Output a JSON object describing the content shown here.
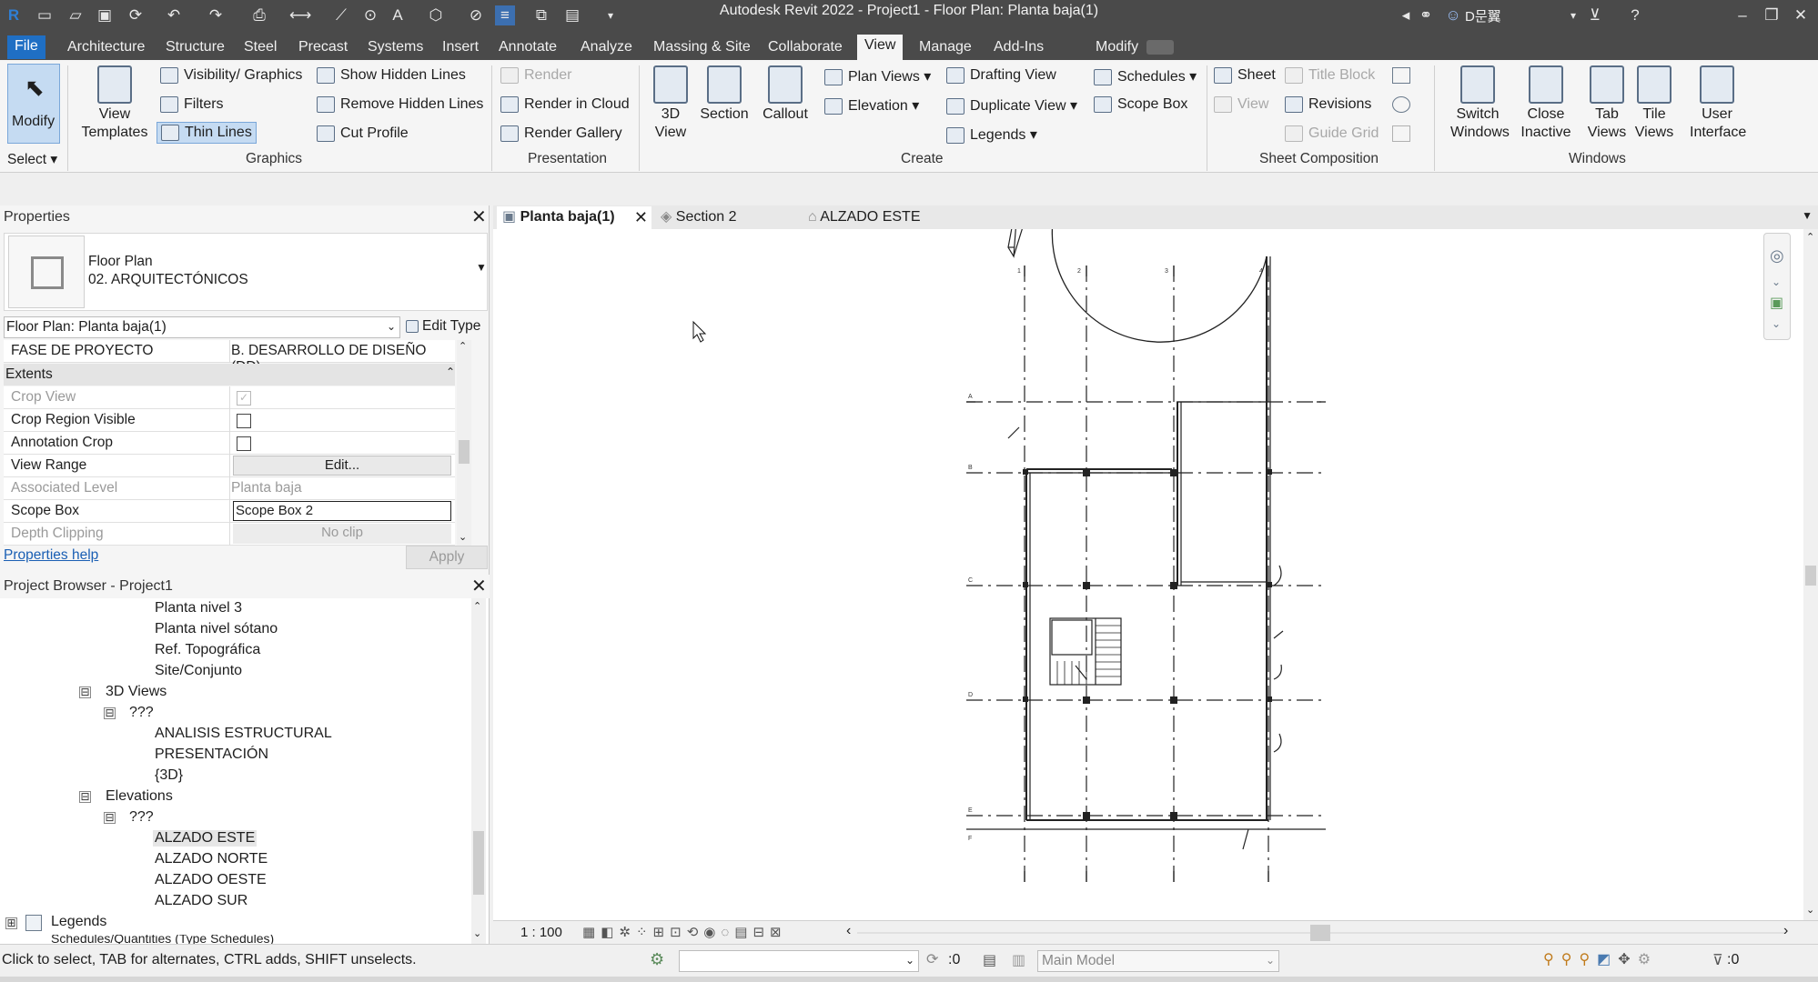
{
  "title_bar": {
    "app_title": "Autodesk Revit 2022 - Project1 - Floor Plan: Planta baja(1)",
    "user_name": "D문翼"
  },
  "menu": [
    "File",
    "Architecture",
    "Structure",
    "Steel",
    "Precast",
    "Systems",
    "Insert",
    "Annotate",
    "Analyze",
    "Massing & Site",
    "Collaborate",
    "View",
    "Manage",
    "Add-Ins",
    "Modify"
  ],
  "menu_active": "View",
  "ribbon": {
    "select": {
      "modify": "Modify",
      "select": "Select"
    },
    "graphics": {
      "label": "Graphics",
      "view_templates": "View Templates",
      "visibility": "Visibility/ Graphics",
      "filters": "Filters",
      "thin_lines": "Thin Lines",
      "show_hidden": "Show  Hidden Lines",
      "remove_hidden": "Remove  Hidden Lines",
      "cut_profile": "Cut  Profile"
    },
    "presentation": {
      "label": "Presentation",
      "render": "Render",
      "render_cloud": "Render  in Cloud",
      "render_gallery": "Render  Gallery"
    },
    "create": {
      "label": "Create",
      "view3d": "3D View",
      "section": "Section",
      "callout": "Callout",
      "plan_views": "Plan  Views",
      "elevation": "Elevation",
      "drafting_view": "Drafting  View",
      "duplicate_view": "Duplicate  View",
      "legends": "Legends",
      "schedules": "Schedules",
      "scope_box": "Scope  Box"
    },
    "sheet_composition": {
      "label": "Sheet Composition",
      "sheet": "Sheet",
      "title_block": "Title  Block",
      "view": "View",
      "revisions": "Revisions",
      "guide_grid": "Guide  Grid"
    },
    "windows": {
      "label": "Windows",
      "switch_windows": "Switch Windows",
      "close_inactive": "Close Inactive",
      "tab_views": "Tab Views",
      "tile_views": "Tile Views",
      "user_interface": "User Interface"
    }
  },
  "properties": {
    "title": "Properties",
    "type_line1": "Floor Plan",
    "type_line2": "02. ARQUITECTÓNICOS",
    "instance_selector": "Floor Plan: Planta baja(1)",
    "edit_type": "Edit Type",
    "rows": [
      {
        "key": "FASE DE PROYECTO",
        "value": "B. DESARROLLO DE DISEÑO (DD)"
      },
      {
        "key": "Crop View",
        "value": ""
      },
      {
        "key": "Crop Region Visible",
        "value": ""
      },
      {
        "key": "Annotation Crop",
        "value": ""
      },
      {
        "key": "View Range",
        "value": "Edit..."
      },
      {
        "key": "Associated Level",
        "value": "Planta baja"
      },
      {
        "key": "Scope Box",
        "value": "Scope Box 2"
      },
      {
        "key": "Depth Clipping",
        "value": "No clip"
      }
    ],
    "section_extents": "Extents",
    "help": "Properties help",
    "apply": "Apply"
  },
  "browser": {
    "title": "Project Browser - Project1",
    "items": [
      "Planta nivel 3",
      "Planta nivel sótano",
      "Ref. Topográfica",
      "Site/Conjunto",
      "3D Views",
      "???",
      "ANALISIS ESTRUCTURAL",
      "PRESENTACIÓN",
      "{3D}",
      "Elevations",
      "???",
      "ALZADO ESTE",
      "ALZADO NORTE",
      "ALZADO OESTE",
      "ALZADO SUR",
      "Legends",
      "Schedules/Quantities (Type Schedules)"
    ],
    "expand_minus": "⊟",
    "expand_plus": "⊞"
  },
  "view_tabs": [
    "Planta baja(1)",
    "Section 2",
    "ALZADO ESTE"
  ],
  "view_control": {
    "scale": "1 : 100"
  },
  "status": {
    "hint": "Click to select, TAB for alternates, CTRL adds, SHIFT unselects.",
    "count_a": ":0",
    "workset": "Main Model",
    "filter_count": ":0"
  },
  "plan_grid": {
    "grid_h": [
      "1",
      "2",
      "3",
      "4"
    ],
    "grid_v": [
      "A",
      "B",
      "C",
      "D",
      "E",
      "F"
    ]
  }
}
